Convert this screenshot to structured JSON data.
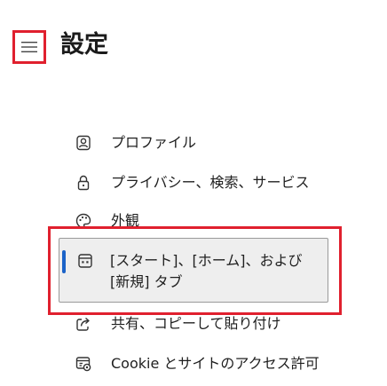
{
  "header": {
    "title": "設定",
    "menu_icon": "hamburger-menu-icon"
  },
  "nav": {
    "items": [
      {
        "label": "プロファイル",
        "icon": "profile-icon"
      },
      {
        "label": "プライバシー、検索、サービス",
        "icon": "lock-icon"
      },
      {
        "label": "外観",
        "icon": "palette-icon"
      },
      {
        "label": "[スタート]、[ホーム]、および [新規] タブ",
        "icon": "new-tab-icon",
        "selected": true
      },
      {
        "label": "共有、コピーして貼り付け",
        "icon": "share-icon"
      },
      {
        "label": "Cookie とサイトのアクセス許可",
        "icon": "site-permissions-icon"
      }
    ]
  },
  "colors": {
    "highlight_border": "#e0202e",
    "selected_indicator": "#1b63c8",
    "selected_background": "#eeeeee"
  }
}
